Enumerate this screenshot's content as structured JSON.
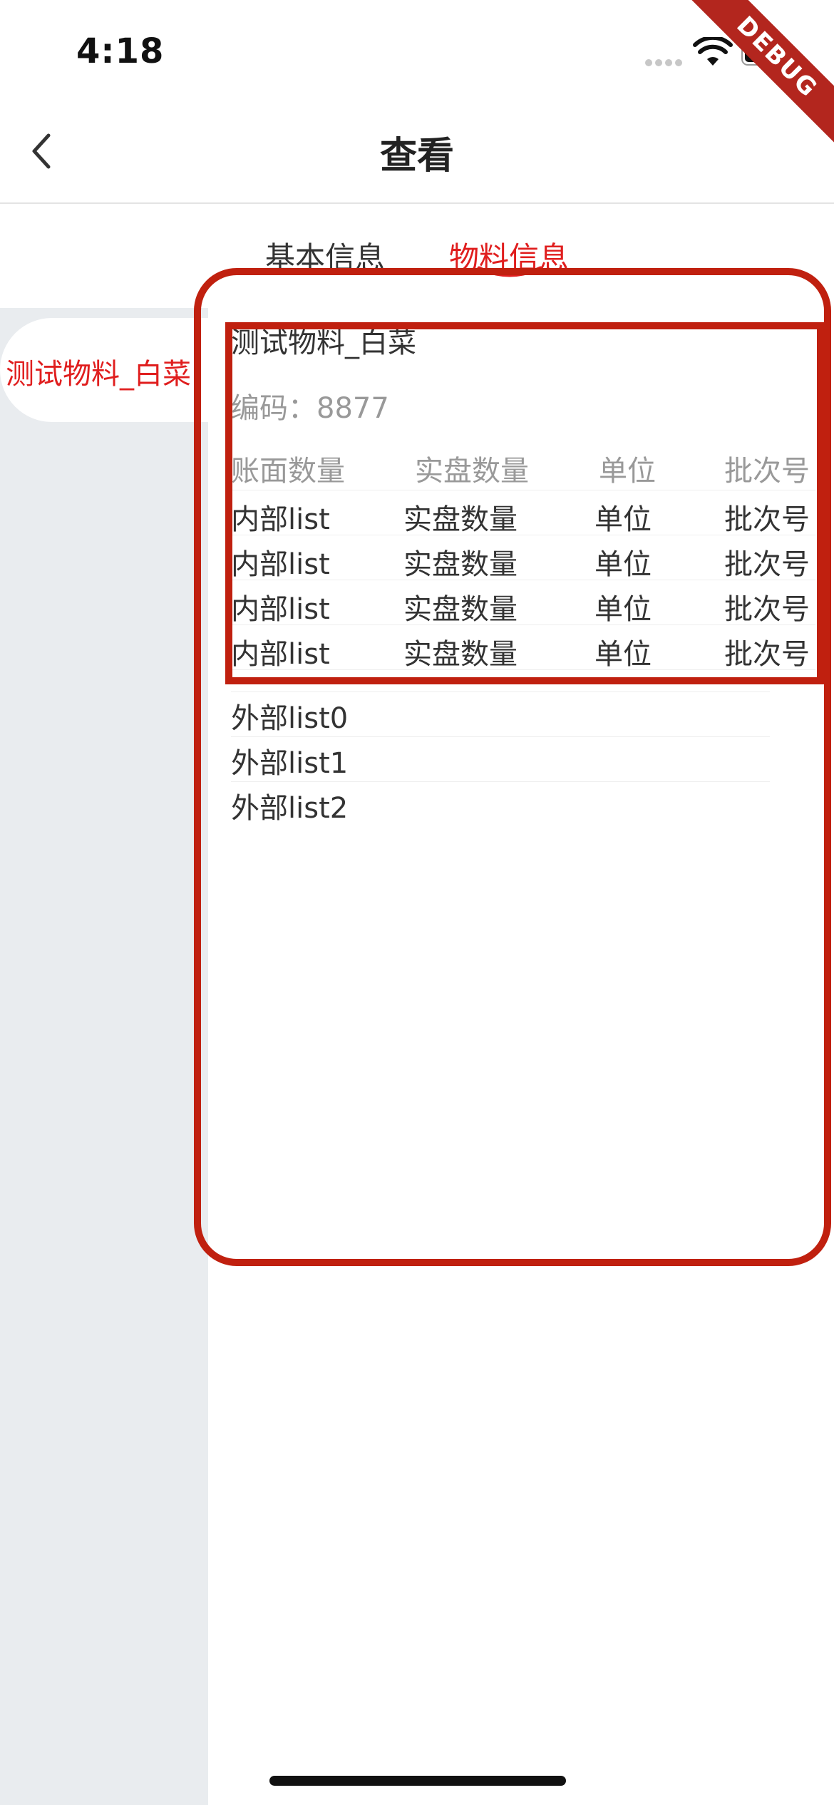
{
  "status_bar": {
    "time": "4:18"
  },
  "debug_banner": "DEBUG",
  "nav": {
    "title": "查看"
  },
  "tabs": [
    {
      "label": "基本信息",
      "active": false
    },
    {
      "label": "物料信息",
      "active": true
    }
  ],
  "sidebar": {
    "items": [
      {
        "label": "测试物料_白菜",
        "selected": true
      }
    ]
  },
  "material": {
    "name": "测试物料_白菜",
    "code_label": "编码：8877"
  },
  "inner_table": {
    "headers": [
      "账面数量",
      "实盘数量",
      "单位",
      "批次号"
    ],
    "rows": [
      [
        "内部list",
        "实盘数量",
        "单位",
        "批次号"
      ],
      [
        "内部list",
        "实盘数量",
        "单位",
        "批次号"
      ],
      [
        "内部list",
        "实盘数量",
        "单位",
        "批次号"
      ],
      [
        "内部list",
        "实盘数量",
        "单位",
        "批次号"
      ]
    ]
  },
  "outer_list": [
    "外部list0",
    "外部list1",
    "外部list2"
  ],
  "colors": {
    "accent": "#e01e1e",
    "annotation": "#c0200f",
    "sidebar_bg": "#e9ecef"
  }
}
